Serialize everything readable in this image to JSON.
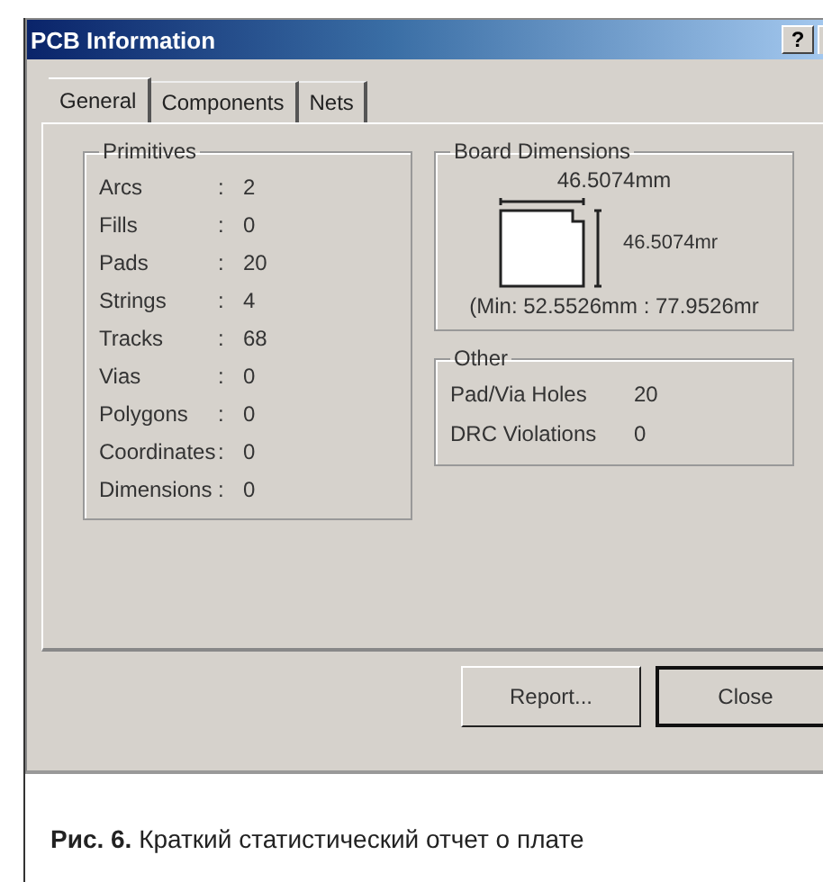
{
  "window": {
    "title": "PCB Information",
    "help_button": "?"
  },
  "tabs": [
    {
      "label": "General",
      "selected": true
    },
    {
      "label": "Components",
      "selected": false
    },
    {
      "label": "Nets",
      "selected": false
    }
  ],
  "primitives": {
    "title": "Primitives",
    "rows": [
      {
        "label": "Arcs",
        "sep": ":",
        "value": "2"
      },
      {
        "label": "Fills",
        "sep": ":",
        "value": "0"
      },
      {
        "label": "Pads",
        "sep": ":",
        "value": "20"
      },
      {
        "label": "Strings",
        "sep": ":",
        "value": "4"
      },
      {
        "label": "Tracks",
        "sep": ":",
        "value": "68"
      },
      {
        "label": "Vias",
        "sep": ":",
        "value": "0"
      },
      {
        "label": "Polygons",
        "sep": ":",
        "value": "0"
      },
      {
        "label": "Coordinates",
        "sep": ":",
        "value": "0"
      },
      {
        "label": "Dimensions",
        "sep": ":",
        "value": "0"
      }
    ]
  },
  "board_dimensions": {
    "title": "Board Dimensions",
    "width": "46.5074mm",
    "height": "46.5074mr",
    "min": "(Min: 52.5526mm : 77.9526mr"
  },
  "other": {
    "title": "Other",
    "rows": [
      {
        "label": "Pad/Via Holes",
        "value": "20"
      },
      {
        "label": "DRC Violations",
        "value": "0"
      }
    ]
  },
  "buttons": [
    {
      "label": "Report...",
      "default": false
    },
    {
      "label": "Close",
      "default": true
    }
  ],
  "caption": {
    "number": "Рис. 6.",
    "text": "Краткий статистический отчет о плате"
  }
}
